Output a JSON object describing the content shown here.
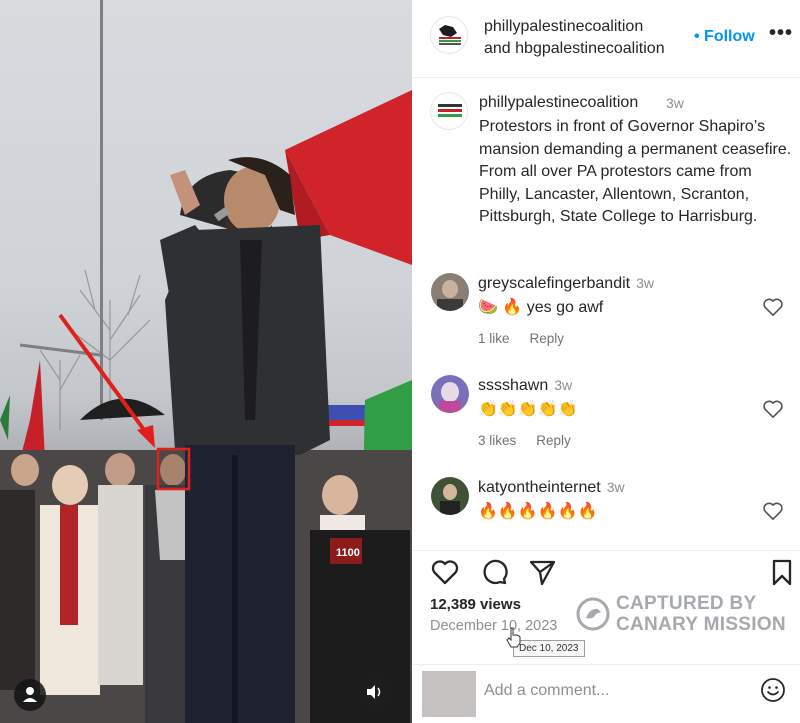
{
  "header": {
    "username_1": "phillypalestinecoalition",
    "username_2": "and hbgpalestinecoalition",
    "follow_label": "• Follow",
    "more_label": "•••"
  },
  "caption": {
    "username": "phillypalestinecoalition",
    "time": "3w",
    "text": "Protestors in front of Governor Shapiro’s mansion demanding a permanent ceasefire. From all over PA protestors came from Philly, Lancaster, Allentown, Scranton, Pittsburgh, State College to Harrisburg."
  },
  "comments": [
    {
      "username": "greyscalefingerbandit",
      "time": "3w",
      "text": "🍉 🔥 yes go awf",
      "likes": "1 like",
      "reply": "Reply"
    },
    {
      "username": "sssshawn",
      "time": "3w",
      "text": "👏👏👏👏👏",
      "likes": "3 likes",
      "reply": "Reply"
    },
    {
      "username": "katyontheinternet",
      "time": "3w",
      "text": "🔥🔥🔥🔥🔥🔥"
    }
  ],
  "post": {
    "views": "12,389 views",
    "date": "December 10, 2023",
    "date_tooltip": "Dec 10, 2023"
  },
  "watermark": {
    "line1": "CAPTURED BY",
    "line2": "CANARY MISSION"
  },
  "add_comment": {
    "placeholder": "Add a comment..."
  },
  "icons": {
    "like": "heart-icon",
    "comment": "comment-bubble-icon",
    "share": "paper-plane-icon",
    "save": "bookmark-icon",
    "emoji": "smiley-icon",
    "sound": "speaker-icon",
    "user": "user-tag-icon"
  },
  "photo": {
    "banner_text": "1100"
  },
  "colors": {
    "link_blue": "#0095f6",
    "annotation_red": "#e0201b",
    "tent_red": "#d0232a"
  }
}
